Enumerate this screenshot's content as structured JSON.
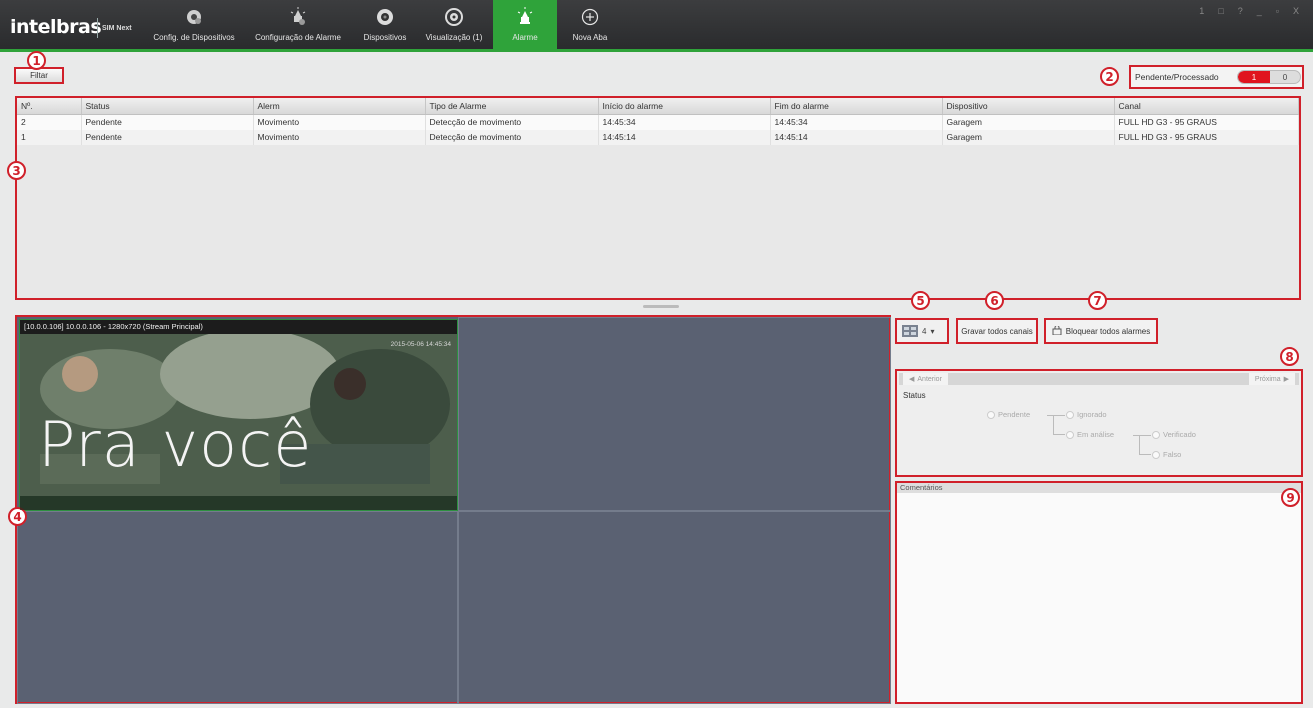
{
  "app": {
    "logo": "intelbras",
    "logo_sub": "SIM Next"
  },
  "nav": {
    "items": [
      {
        "label": "Config. de Dispositivos",
        "icon": "devices-config-icon"
      },
      {
        "label": "Configuração de Alarme",
        "icon": "alarm-config-icon"
      },
      {
        "label": "Dispositivos",
        "icon": "camera-icon"
      },
      {
        "label": "Visualização (1)",
        "icon": "view-icon"
      },
      {
        "label": "Alarme",
        "icon": "alarm-icon",
        "active": true
      },
      {
        "label": "Nova Aba",
        "icon": "add-tab-icon"
      }
    ]
  },
  "window_controls": [
    "1",
    "□",
    "?",
    "_",
    "▫",
    "X"
  ],
  "toolbar": {
    "filter_label": "Filtar"
  },
  "toggle": {
    "label": "Pendente/Processado",
    "pending_count": "1",
    "processed_count": "0"
  },
  "alarm_table": {
    "columns": [
      "Nº.",
      "Status",
      "Alerm",
      "Tipo de Alarme",
      "Início do alarme",
      "Fim do alarme",
      "Dispositivo",
      "Canal"
    ],
    "rows": [
      [
        "2",
        "Pendente",
        "Movimento",
        "Detecção de movimento",
        "14:45:34",
        "14:45:34",
        "Garagem",
        "FULL HD G3 - 95 GRAUS"
      ],
      [
        "1",
        "Pendente",
        "Movimento",
        "Detecção de movimento",
        "14:45:14",
        "14:45:14",
        "Garagem",
        "FULL HD G3 - 95 GRAUS"
      ]
    ]
  },
  "video": {
    "header": "[10.0.0.106] 10.0.0.106 - 1280x720 (Stream Principal)",
    "timestamp": "2015-05-06 14:45:34",
    "overlay_text": "Pra você"
  },
  "controls": {
    "layout_value": "4",
    "record_all_label": "Gravar todos canais",
    "block_all_label": "Bloquear todos alarmes"
  },
  "status_panel": {
    "prev_label": "Anterior",
    "next_label": "Próxima",
    "status_title": "Status",
    "options": {
      "pendente": "Pendente",
      "ignorado": "Ignorado",
      "em_analise": "Em análise",
      "verificado": "Verificado",
      "falso": "Falso"
    }
  },
  "comments": {
    "title": "Comentários"
  },
  "markers": [
    "1",
    "2",
    "3",
    "4",
    "5",
    "6",
    "7",
    "8",
    "9"
  ],
  "colors": {
    "accent_green": "#2fa33a",
    "highlight_red": "#d0202a",
    "pending_red": "#e0141e",
    "video_bg": "#5a6172"
  }
}
